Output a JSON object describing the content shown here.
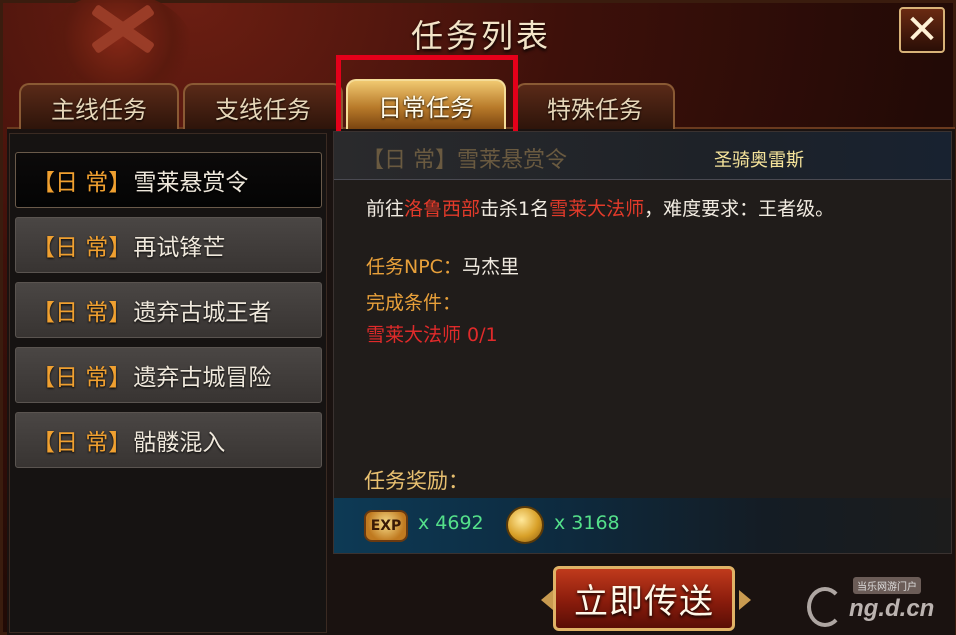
{
  "window": {
    "title": "任务列表",
    "close_icon": "close-icon (✕)"
  },
  "tabs": [
    {
      "label": "主线任务",
      "active": false
    },
    {
      "label": "支线任务",
      "active": false
    },
    {
      "label": "日常任务",
      "active": true
    },
    {
      "label": "特殊任务",
      "active": false
    }
  ],
  "quests": [
    {
      "tag": "【日 常】",
      "name": "雪莱悬赏令",
      "selected": true
    },
    {
      "tag": "【日 常】",
      "name": "再试锋芒",
      "selected": false
    },
    {
      "tag": "【日 常】",
      "name": "遗弃古城王者",
      "selected": false
    },
    {
      "tag": "【日 常】",
      "name": "遗弃古城冒险",
      "selected": false
    },
    {
      "tag": "【日 常】",
      "name": "骷髅混入",
      "selected": false
    }
  ],
  "detail": {
    "header_title": "【日 常】雪莱悬赏令",
    "header_npc": "圣骑奥雷斯",
    "desc_prefix": "前往",
    "desc_location": "洛鲁西部",
    "desc_mid": "击杀1名",
    "desc_target": "雪莱大法师",
    "desc_suffix": "，难度要求：王者级。",
    "npc_label": "任务NPC：",
    "npc_name": "马杰里",
    "condition_label": "完成条件：",
    "condition_value": "雪莱大法师  0/1",
    "reward_label": "任务奖励：",
    "exp_icon_text": "EXP",
    "exp_value": "x 4692",
    "coin_value": "x 3168"
  },
  "teleport_button": "立即传送",
  "watermark": {
    "small": "当乐网游门户",
    "text": "ng.d.cn"
  },
  "colors": {
    "accent_orange": "#f0a030",
    "highlight_red": "#e4001a",
    "reward_green": "#54e08a"
  }
}
